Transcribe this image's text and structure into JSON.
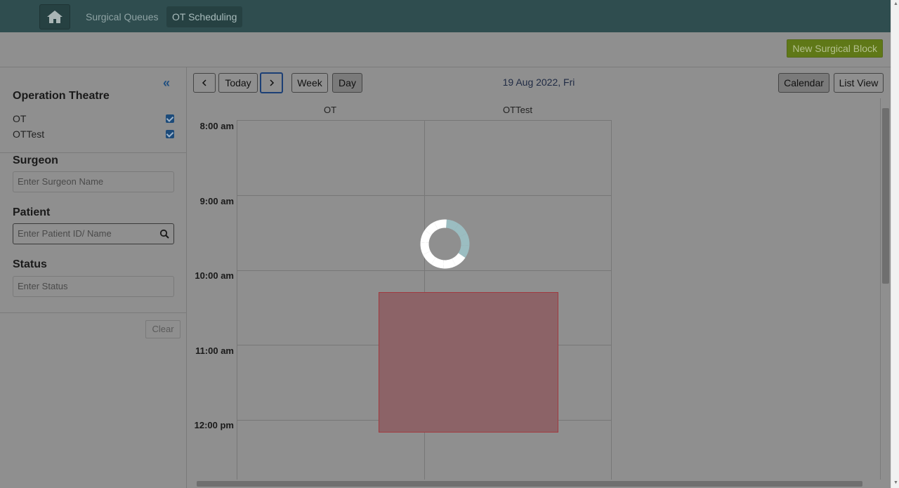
{
  "nav": {
    "home_icon": "home-icon",
    "links": [
      {
        "label": "Surgical Queues"
      },
      {
        "label": "OT Scheduling"
      }
    ]
  },
  "actions": {
    "new_block_label": "New Surgical Block"
  },
  "sidebar": {
    "collapse_icon": "double-chevron-left-icon",
    "ot_section": {
      "title": "Operation Theatre",
      "items": [
        {
          "label": "OT",
          "checked": true
        },
        {
          "label": "OTTest",
          "checked": true
        }
      ]
    },
    "surgeon": {
      "title": "Surgeon",
      "placeholder": "Enter Surgeon Name"
    },
    "patient": {
      "title": "Patient",
      "placeholder": "Enter Patient ID/ Name"
    },
    "status": {
      "title": "Status",
      "placeholder": "Enter Status"
    },
    "clear_label": "Clear"
  },
  "calendar": {
    "toolbar": {
      "prev_icon": "chevron-left-icon",
      "today_label": "Today",
      "next_icon": "chevron-right-icon",
      "week_label": "Week",
      "day_label": "Day",
      "date_title": "19 Aug 2022, Fri",
      "calendar_label": "Calendar",
      "list_view_label": "List View"
    },
    "columns": [
      "OT",
      "OTTest"
    ],
    "time_slots": [
      "8:00 am",
      "9:00 am",
      "10:00 am",
      "11:00 am",
      "12:00 pm"
    ],
    "event_color": "#a13a3f"
  },
  "colors": {
    "topbar": "#2f4d4f",
    "accent_button": "#5f7817",
    "overlay": "#8f8f8f"
  }
}
